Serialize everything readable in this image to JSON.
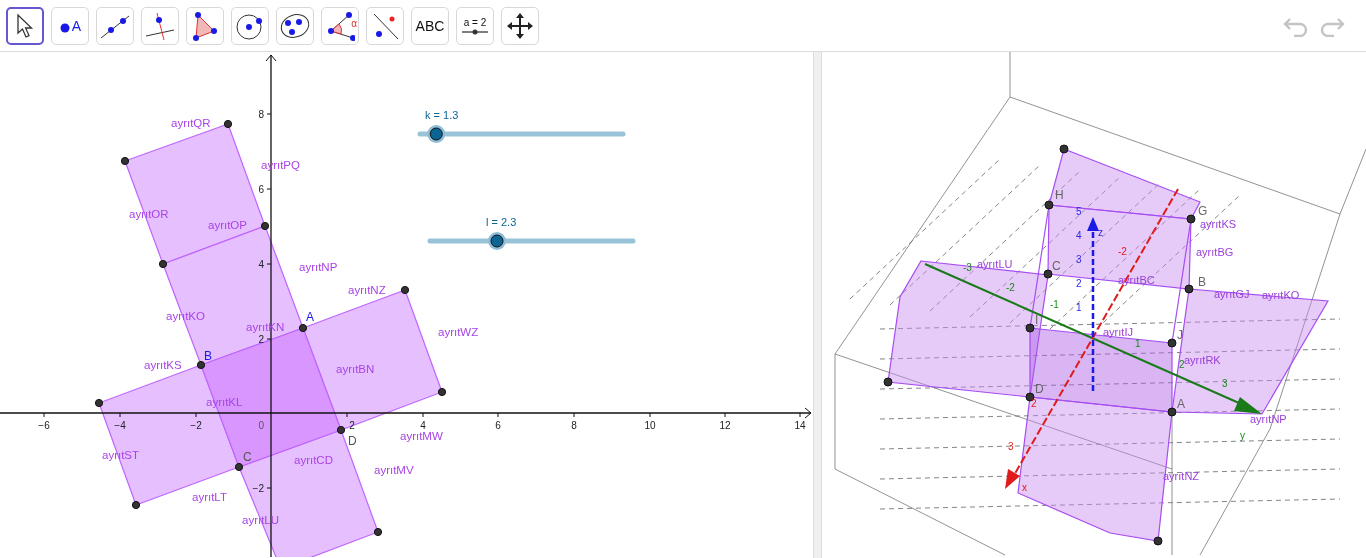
{
  "toolbar": {
    "tools": [
      {
        "kind": "move",
        "selected": true
      },
      {
        "kind": "point",
        "label": "A",
        "selected": false
      },
      {
        "kind": "line",
        "selected": false
      },
      {
        "kind": "perpendicular",
        "selected": false
      },
      {
        "kind": "polygon",
        "selected": false
      },
      {
        "kind": "circle",
        "selected": false
      },
      {
        "kind": "conic",
        "selected": false
      },
      {
        "kind": "angle",
        "label": "α",
        "selected": false
      },
      {
        "kind": "reflect",
        "selected": false
      },
      {
        "kind": "text",
        "label": "ABC",
        "selected": false
      },
      {
        "kind": "slider",
        "label": "a = 2",
        "selected": false
      },
      {
        "kind": "pan",
        "selected": false
      }
    ]
  },
  "graphics": {
    "x_ticks": [
      "−6",
      "−4",
      "−2",
      "2",
      "4",
      "6",
      "8",
      "10",
      "12",
      "14"
    ],
    "y_ticks": [
      "8",
      "6",
      "4",
      "2",
      "−2"
    ],
    "origin": "0",
    "sliders": [
      {
        "label": "k = 1.3",
        "level": 0.08
      },
      {
        "label": "l = 2.3",
        "level": 0.33
      }
    ],
    "edge_labels": [
      "ayrıtQR",
      "ayrıtPQ",
      "ayrıtOR",
      "ayrıtOP",
      "ayrıtNP",
      "ayrıtNZ",
      "ayrıtKO",
      "ayrıtKN",
      "ayrıtWZ",
      "ayrıtKS",
      "ayrıtBN",
      "ayrıtKL",
      "ayrıtMW",
      "ayrıtST",
      "ayrıtCD",
      "ayrıtMV",
      "ayrıtLT",
      "ayrıtLU"
    ],
    "point_labels": [
      "A",
      "B",
      "C",
      "D"
    ]
  },
  "graphics_3d": {
    "point_labels": [
      "H",
      "G",
      "C",
      "B",
      "I",
      "J",
      "D",
      "A"
    ],
    "edge_labels": [
      "ayrıtKS",
      "ayrıtBG",
      "ayrıtGJ",
      "ayrıtKO",
      "ayrıtLU",
      "ayrıtBC",
      "ayrıtIJ",
      "ayrıtRK",
      "ayrıtNP",
      "ayrıtNZ"
    ],
    "x_ticks": [
      "-2",
      "2",
      "3"
    ],
    "y_ticks": [
      "-3",
      "-2",
      "-1",
      "1",
      "2",
      "3"
    ],
    "z_ticks": [
      "5",
      "4",
      "3",
      "2",
      "1"
    ],
    "axis_labels": [
      "x",
      "y",
      "z"
    ]
  }
}
